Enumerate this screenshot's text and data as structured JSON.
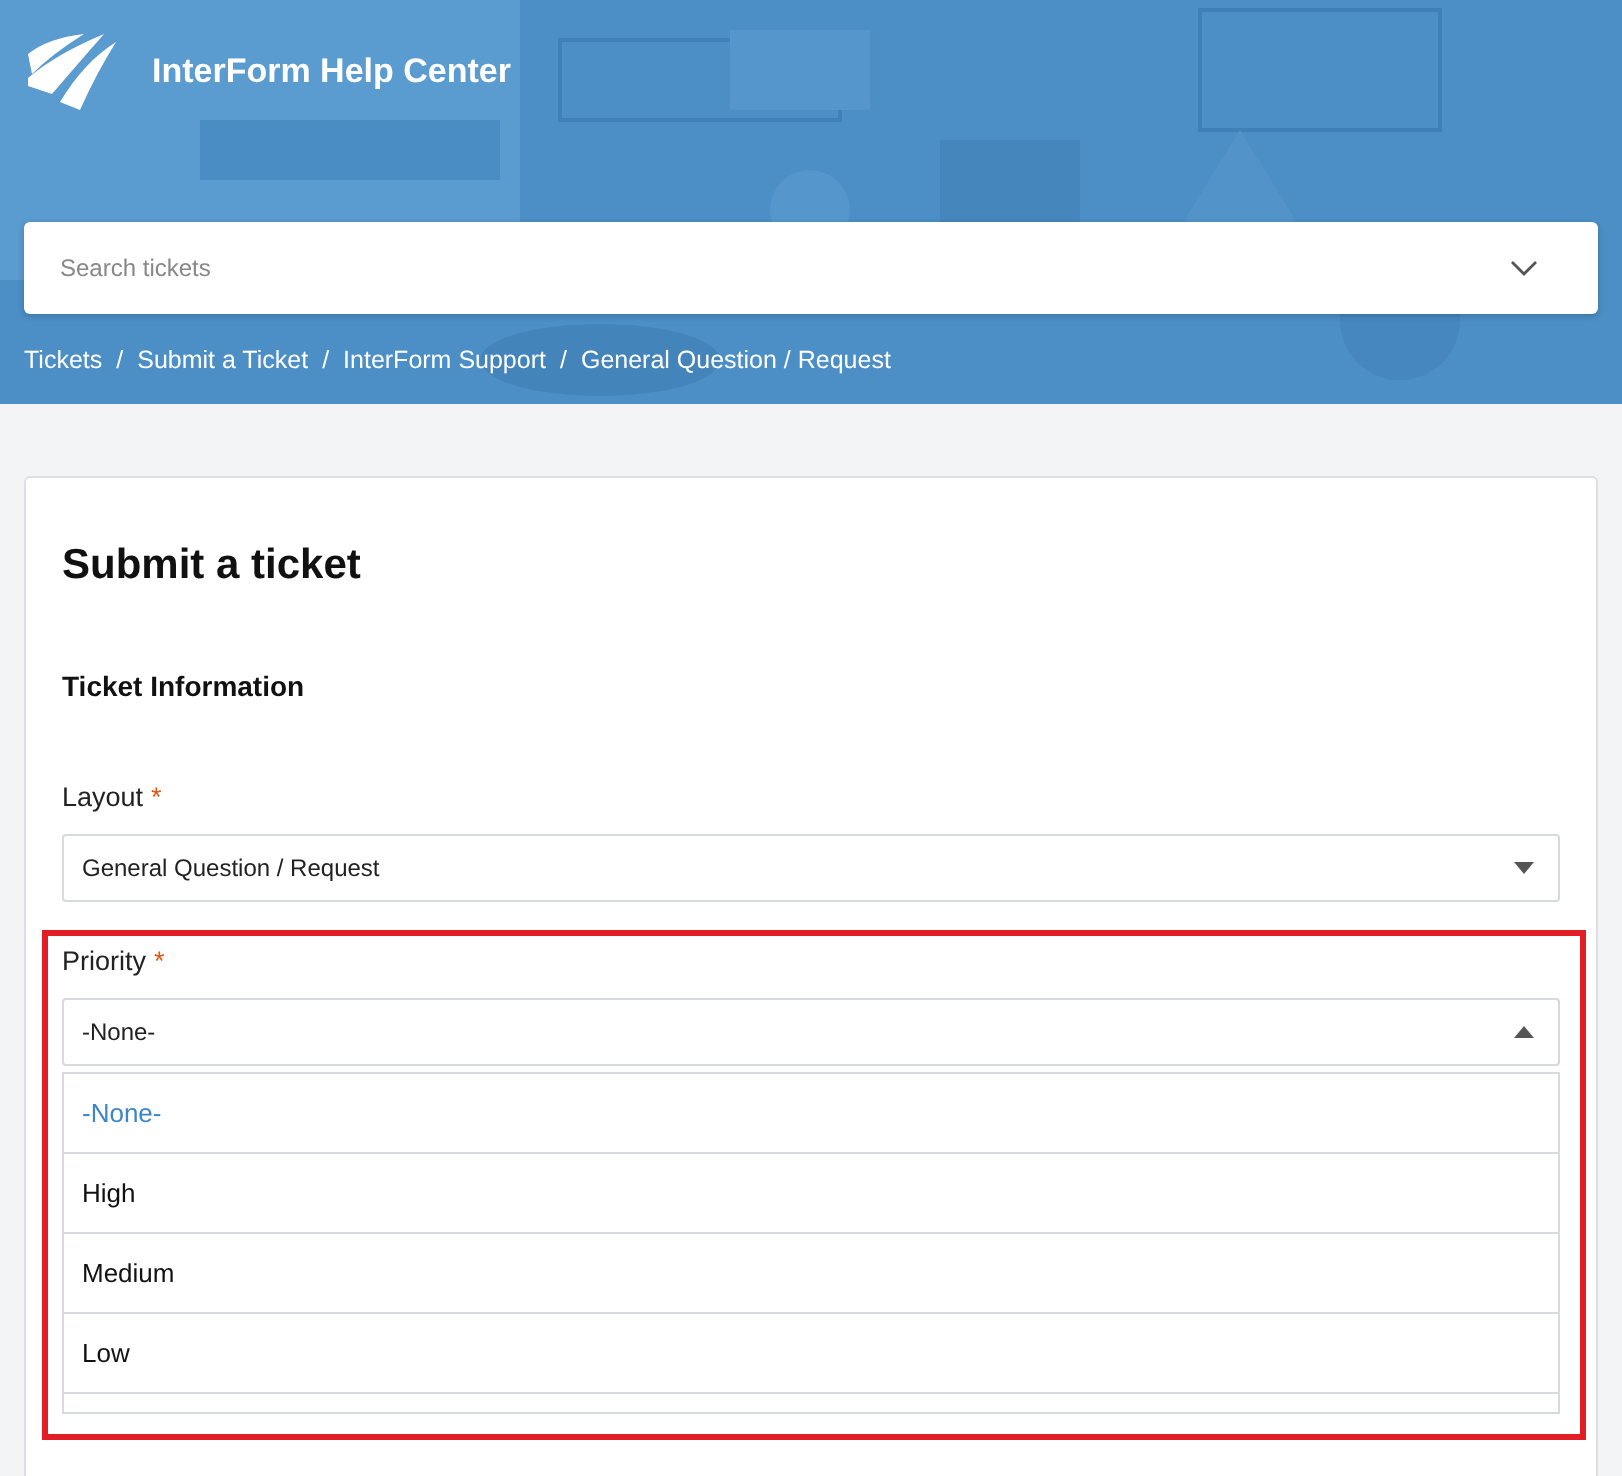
{
  "header": {
    "kind": "picture",
    "title": "InterForm Help Center",
    "search": {
      "placeholder": "Search tickets"
    },
    "separator": "/",
    "breadcrumbs": [
      "Tickets",
      "Submit a Ticket",
      "InterForm Support",
      "General Question / Request"
    ]
  },
  "form": {
    "title": "Submit a ticket",
    "section": "Ticket Information",
    "fields": [
      {
        "label": "Layout",
        "required": "*",
        "value": "General Question / Request",
        "expanded": false,
        "highlighted": false
      },
      {
        "label": "Priority",
        "required": "*",
        "value": "-None-",
        "expanded": true,
        "highlighted": true,
        "options": [
          {
            "label": "-None-",
            "selected": true
          },
          {
            "label": "High",
            "selected": false
          },
          {
            "label": "Medium",
            "selected": false
          },
          {
            "label": "Low",
            "selected": false
          }
        ]
      }
    ]
  }
}
